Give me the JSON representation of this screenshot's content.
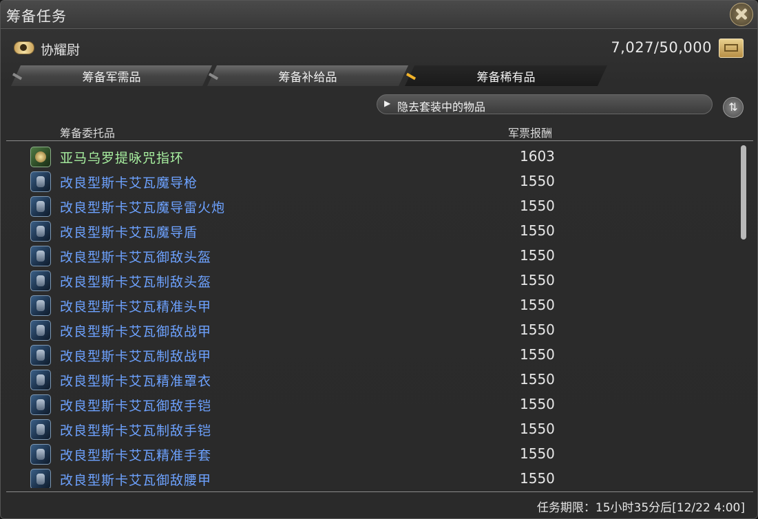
{
  "window": {
    "title": "筹备任务"
  },
  "rank": {
    "label": "协耀尉"
  },
  "seals": {
    "value": "7,027/50,000"
  },
  "tabs": [
    {
      "label": "筹备军需品",
      "active": false
    },
    {
      "label": "筹备补给品",
      "active": false
    },
    {
      "label": "筹备稀有品",
      "active": true
    }
  ],
  "filter": {
    "label": "隐去套装中的物品"
  },
  "columns": {
    "item": "筹备委托品",
    "reward": "军票报酬"
  },
  "items": [
    {
      "name": "亚马乌罗提咏咒指环",
      "reward": "1603",
      "color": "green"
    },
    {
      "name": "改良型斯卡艾瓦魔导枪",
      "reward": "1550",
      "color": "blue"
    },
    {
      "name": "改良型斯卡艾瓦魔导雷火炮",
      "reward": "1550",
      "color": "blue"
    },
    {
      "name": "改良型斯卡艾瓦魔导盾",
      "reward": "1550",
      "color": "blue"
    },
    {
      "name": "改良型斯卡艾瓦御敌头盔",
      "reward": "1550",
      "color": "blue"
    },
    {
      "name": "改良型斯卡艾瓦制敌头盔",
      "reward": "1550",
      "color": "blue"
    },
    {
      "name": "改良型斯卡艾瓦精准头甲",
      "reward": "1550",
      "color": "blue"
    },
    {
      "name": "改良型斯卡艾瓦御敌战甲",
      "reward": "1550",
      "color": "blue"
    },
    {
      "name": "改良型斯卡艾瓦制敌战甲",
      "reward": "1550",
      "color": "blue"
    },
    {
      "name": "改良型斯卡艾瓦精准罩衣",
      "reward": "1550",
      "color": "blue"
    },
    {
      "name": "改良型斯卡艾瓦御敌手铠",
      "reward": "1550",
      "color": "blue"
    },
    {
      "name": "改良型斯卡艾瓦制敌手铠",
      "reward": "1550",
      "color": "blue"
    },
    {
      "name": "改良型斯卡艾瓦精准手套",
      "reward": "1550",
      "color": "blue"
    },
    {
      "name": "改良型斯卡艾瓦御敌腰甲",
      "reward": "1550",
      "color": "blue"
    }
  ],
  "footer": {
    "deadline": "任务期限：15小时35分后[12/22 4:00]"
  },
  "colors": {
    "item_green": "#a8f0a0",
    "item_blue": "#6da2ff",
    "active_tab_marker": "#f2b32a"
  }
}
